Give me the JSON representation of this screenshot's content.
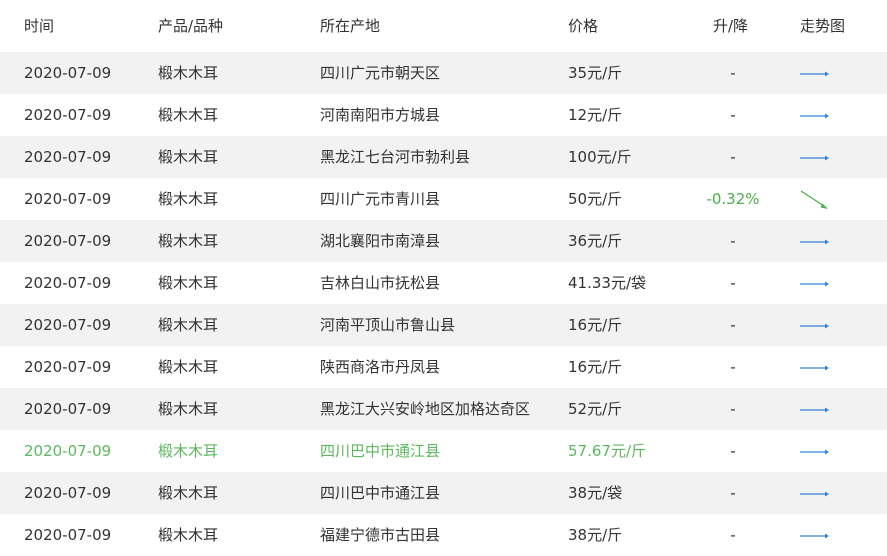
{
  "headers": {
    "date": "时间",
    "product": "产品/品种",
    "location": "所在产地",
    "price": "价格",
    "change": "升/降",
    "trend": "走势图"
  },
  "colors": {
    "flat_arrow": "#2f86d9",
    "down_arrow": "#4cae4c",
    "highlight": "#5cb85c",
    "stripe": "#f2f2f2"
  },
  "rows": [
    {
      "date": "2020-07-09",
      "product": "椴木木耳",
      "location": "四川广元市朝天区",
      "price": "35元/斤",
      "change": "-",
      "trend_icon": "flat-arrow-icon"
    },
    {
      "date": "2020-07-09",
      "product": "椴木木耳",
      "location": "河南南阳市方城县",
      "price": "12元/斤",
      "change": "-",
      "trend_icon": "flat-arrow-icon"
    },
    {
      "date": "2020-07-09",
      "product": "椴木木耳",
      "location": "黑龙江七台河市勃利县",
      "price": "100元/斤",
      "change": "-",
      "trend_icon": "flat-arrow-icon"
    },
    {
      "date": "2020-07-09",
      "product": "椴木木耳",
      "location": "四川广元市青川县",
      "price": "50元/斤",
      "change": "-0.32%",
      "trend_icon": "down-arrow-icon"
    },
    {
      "date": "2020-07-09",
      "product": "椴木木耳",
      "location": "湖北襄阳市南漳县",
      "price": "36元/斤",
      "change": "-",
      "trend_icon": "flat-arrow-icon"
    },
    {
      "date": "2020-07-09",
      "product": "椴木木耳",
      "location": "吉林白山市抚松县",
      "price": "41.33元/袋",
      "change": "-",
      "trend_icon": "flat-arrow-icon"
    },
    {
      "date": "2020-07-09",
      "product": "椴木木耳",
      "location": "河南平顶山市鲁山县",
      "price": "16元/斤",
      "change": "-",
      "trend_icon": "flat-arrow-icon"
    },
    {
      "date": "2020-07-09",
      "product": "椴木木耳",
      "location": "陕西商洛市丹凤县",
      "price": "16元/斤",
      "change": "-",
      "trend_icon": "flat-arrow-icon"
    },
    {
      "date": "2020-07-09",
      "product": "椴木木耳",
      "location": "黑龙江大兴安岭地区加格达奇区",
      "price": "52元/斤",
      "change": "-",
      "trend_icon": "flat-arrow-icon"
    },
    {
      "date": "2020-07-09",
      "product": "椴木木耳",
      "location": "四川巴中市通江县",
      "price": "57.67元/斤",
      "change": "-",
      "trend_icon": "flat-arrow-icon"
    },
    {
      "date": "2020-07-09",
      "product": "椴木木耳",
      "location": "四川巴中市通江县",
      "price": "38元/袋",
      "change": "-",
      "trend_icon": "flat-arrow-icon"
    },
    {
      "date": "2020-07-09",
      "product": "椴木木耳",
      "location": "福建宁德市古田县",
      "price": "38元/斤",
      "change": "-",
      "trend_icon": "flat-arrow-icon"
    }
  ]
}
